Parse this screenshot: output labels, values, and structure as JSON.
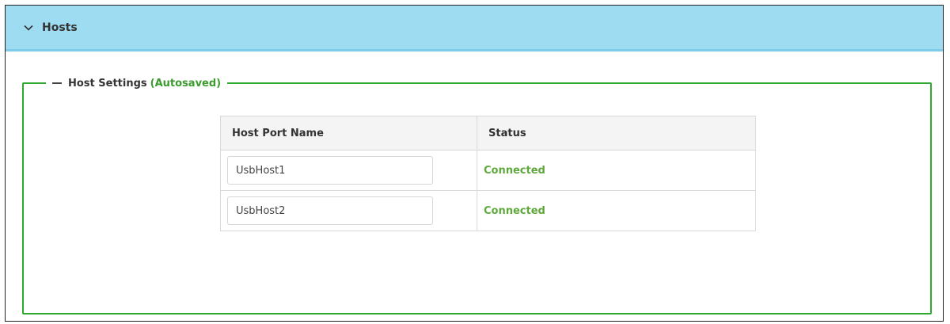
{
  "panel": {
    "title": "Hosts",
    "chevron_icon": "chevron-down-icon",
    "header_color": "#9edcf2"
  },
  "section": {
    "title": "Host Settings",
    "autosave_label": "(Autosaved)",
    "collapse_icon": "minus-icon",
    "border_color": "#2ea82e"
  },
  "table": {
    "headers": [
      "Host Port Name",
      "Status"
    ],
    "rows": [
      {
        "name": "UsbHost1",
        "status": "Connected"
      },
      {
        "name": "UsbHost2",
        "status": "Connected"
      }
    ],
    "status_color": "#5fa83c"
  }
}
